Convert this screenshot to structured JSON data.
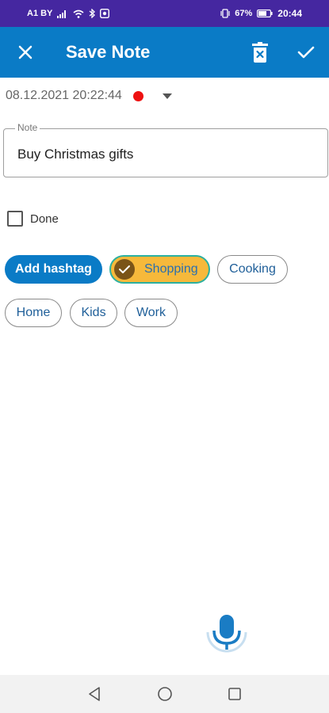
{
  "status_bar": {
    "carrier": "A1 BY",
    "battery": "67%",
    "time": "20:44"
  },
  "app_bar": {
    "title": "Save Note",
    "icons": [
      "close-icon",
      "delete-icon",
      "check-icon"
    ]
  },
  "note": {
    "datetime": "08.12.2021 20:22:44",
    "priority_color": "#ee1111",
    "field_label": "Note",
    "text": "Buy Christmas gifts"
  },
  "done": {
    "label": "Done",
    "checked": false
  },
  "hashtags": {
    "add_label": "Add hashtag",
    "items": [
      {
        "label": "Shopping",
        "selected": true
      },
      {
        "label": "Cooking",
        "selected": false
      },
      {
        "label": "Home",
        "selected": false
      },
      {
        "label": "Kids",
        "selected": false
      },
      {
        "label": "Work",
        "selected": false
      }
    ]
  },
  "colors": {
    "status_bar": "#4527a0",
    "app_bar": "#0a7bc6",
    "selected_chip": "#f6b93b"
  }
}
